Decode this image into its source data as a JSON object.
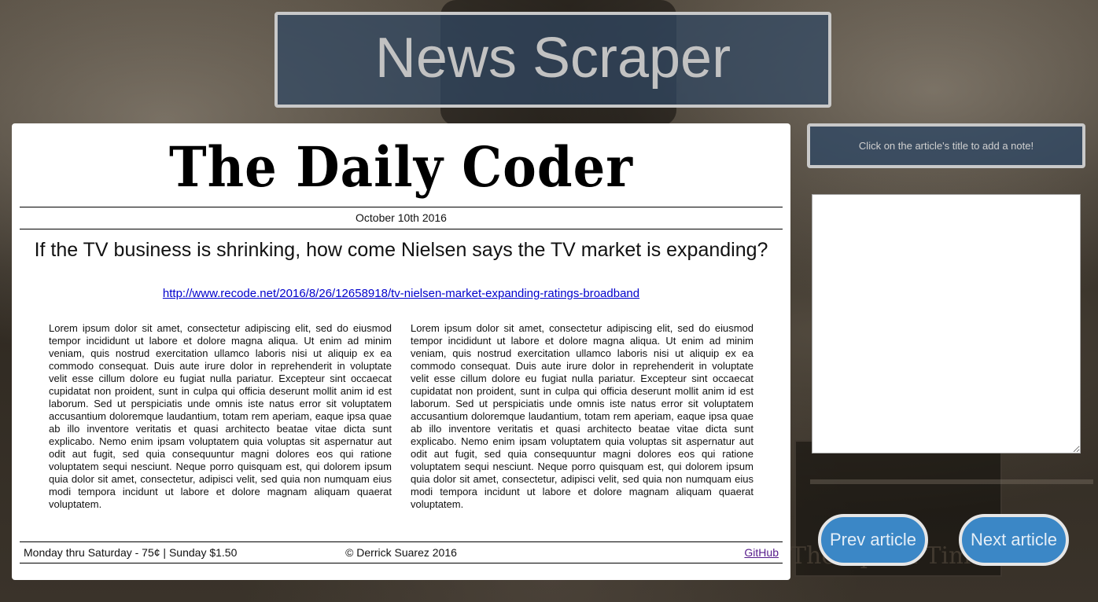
{
  "site": {
    "title": "News Scraper"
  },
  "newspaper": {
    "masthead": "The Daily Coder",
    "date": "October 10th 2016",
    "headline": "If the TV business is shrinking, how come Nielsen says the TV market is expanding?",
    "link": "http://www.recode.net/2016/8/26/12658918/tv-nielsen-market-expanding-ratings-broadband",
    "columns": [
      "Lorem ipsum dolor sit amet, consectetur adipiscing elit, sed do eiusmod tempor incididunt ut labore et dolore magna aliqua. Ut enim ad minim veniam, quis nostrud exercitation ullamco laboris nisi ut aliquip ex ea commodo consequat. Duis aute irure dolor in reprehenderit in voluptate velit esse cillum dolore eu fugiat nulla pariatur. Excepteur sint occaecat cupidatat non proident, sunt in culpa qui officia deserunt mollit anim id est laborum. Sed ut perspiciatis unde omnis iste natus error sit voluptatem accusantium doloremque laudantium, totam rem aperiam, eaque ipsa quae ab illo inventore veritatis et quasi architecto beatae vitae dicta sunt explicabo. Nemo enim ipsam voluptatem quia voluptas sit aspernatur aut odit aut fugit, sed quia consequuntur magni dolores eos qui ratione voluptatem sequi nesciunt. Neque porro quisquam est, qui dolorem ipsum quia dolor sit amet, consectetur, adipisci velit, sed quia non numquam eius modi tempora incidunt ut labore et dolore magnam aliquam quaerat voluptatem.",
      "Lorem ipsum dolor sit amet, consectetur adipiscing elit, sed do eiusmod tempor incididunt ut labore et dolore magna aliqua. Ut enim ad minim veniam, quis nostrud exercitation ullamco laboris nisi ut aliquip ex ea commodo consequat. Duis aute irure dolor in reprehenderit in voluptate velit esse cillum dolore eu fugiat nulla pariatur. Excepteur sint occaecat cupidatat non proident, sunt in culpa qui officia deserunt mollit anim id est laborum. Sed ut perspiciatis unde omnis iste natus error sit voluptatem accusantium doloremque laudantium, totam rem aperiam, eaque ipsa quae ab illo inventore veritatis et quasi architecto beatae vitae dicta sunt explicabo. Nemo enim ipsam voluptatem quia voluptas sit aspernatur aut odit aut fugit, sed quia consequuntur magni dolores eos qui ratione voluptatem sequi nesciunt. Neque porro quisquam est, qui dolorem ipsum quia dolor sit amet, consectetur, adipisci velit, sed quia non numquam eius modi tempora incidunt ut labore et dolore magnam aliquam quaerat voluptatem."
    ],
    "footer": {
      "price": "Monday thru Saturday - 75¢ | Sunday $1.50",
      "copyright": "© Derrick Suarez 2016",
      "github_label": "GitHub"
    }
  },
  "notes": {
    "hint": "Click on the article's title to add a note!",
    "textarea_value": ""
  },
  "nav": {
    "prev_label": "Prev article",
    "next_label": "Next article"
  },
  "background": {
    "newspaper_text": "The Epoch Times"
  },
  "colors": {
    "header_bg": "#30486464",
    "button_bg": "#3b87c6",
    "link": "#0000cc"
  }
}
